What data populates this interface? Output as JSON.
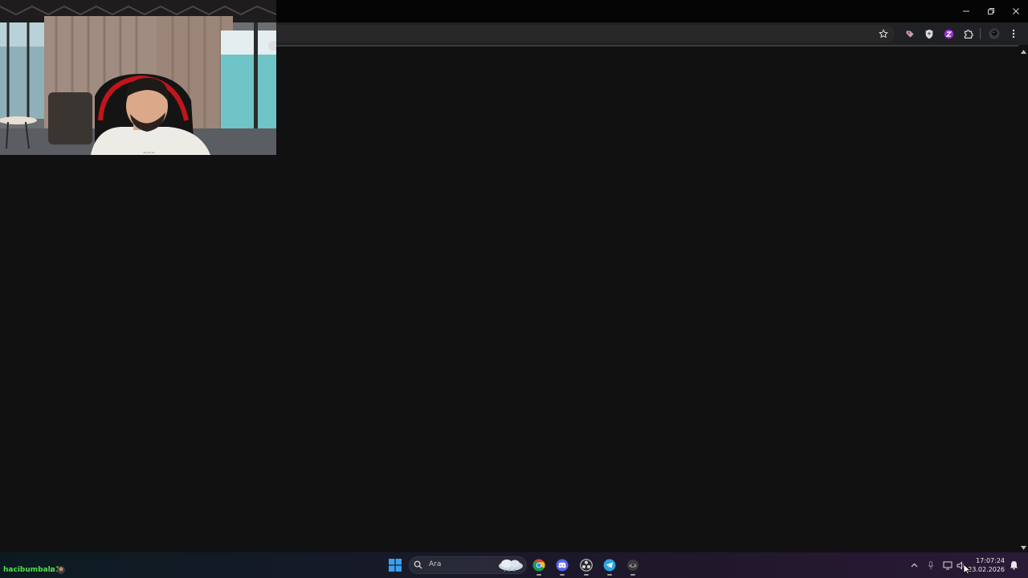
{
  "window": {
    "controls": [
      "minimize",
      "restore",
      "close"
    ]
  },
  "toolbar": {
    "bookmark_icon": "star-icon",
    "extensions": [
      "tag-extension-icon",
      "shield-extension-icon",
      "purple-extension-icon",
      "puzzle-extensions-icon",
      "profile-avatar-icon",
      "kebab-menu-icon"
    ]
  },
  "webcam": {
    "description_icon": "webcam-overlay"
  },
  "chat": {
    "username": "hacibumbala1",
    "colon": ":",
    "username_color": "#53e04a"
  },
  "taskbar": {
    "search_placeholder": "Ara",
    "apps": [
      "windows-start-icon",
      "search-icon",
      "weather-widget-icon",
      "chrome-icon",
      "discord-icon",
      "obs-icon",
      "telegram-icon",
      "game-app-icon"
    ],
    "clock": {
      "time": "17:07:24",
      "date": "23.02.2026"
    }
  },
  "colors": {
    "page_bg": "#111111",
    "toolbar_bg": "#202124",
    "titlebar_bg": "#050505",
    "accent_chrome_yellow": "#fbbc04",
    "discord": "#5865f2",
    "telegram": "#2aa3e0"
  }
}
